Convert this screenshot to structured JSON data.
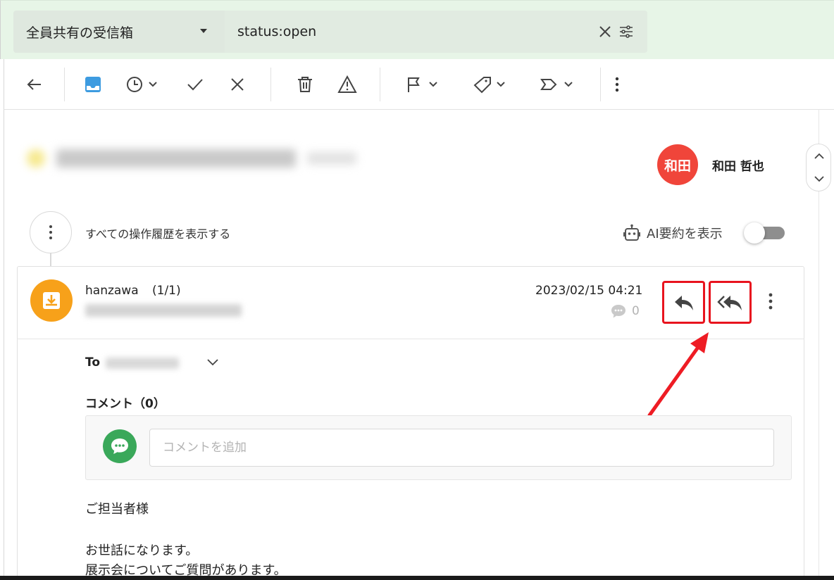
{
  "search": {
    "inbox_label": "全員共有の受信箱",
    "query": "status:open"
  },
  "assignee": {
    "avatar_text": "和田",
    "name": "和田 哲也",
    "avatar_color": "#f0453a"
  },
  "history": {
    "label": "すべての操作履歴を表示する"
  },
  "ai_summary": {
    "label": "AI要約を表示",
    "enabled": false
  },
  "message": {
    "sender": "hanzawa",
    "count": "(1/1)",
    "date": "2023/02/15 04:21",
    "comment_count": "0",
    "to_label": "To",
    "avatar_color": "#f7a11a"
  },
  "comments": {
    "heading": "コメント（0）",
    "placeholder": "コメントを追加"
  },
  "body": {
    "lines": [
      "ご担当者様",
      "お世話になります。",
      "展示会についてご質問があります。"
    ]
  },
  "colors": {
    "search_band": "#e7f5e7",
    "highlight": "#e8141e",
    "accent_blue": "#3d9be0",
    "comment_green": "#3aa85a"
  },
  "icons": [
    "back-arrow-icon",
    "inbox-icon",
    "snooze-clock-icon",
    "check-icon",
    "close-icon",
    "trash-icon",
    "warning-icon",
    "flag-icon",
    "tag-icon",
    "label-icon",
    "more-vertical-icon",
    "reply-icon",
    "reply-all-icon",
    "comment-bubble-icon",
    "robot-icon"
  ]
}
